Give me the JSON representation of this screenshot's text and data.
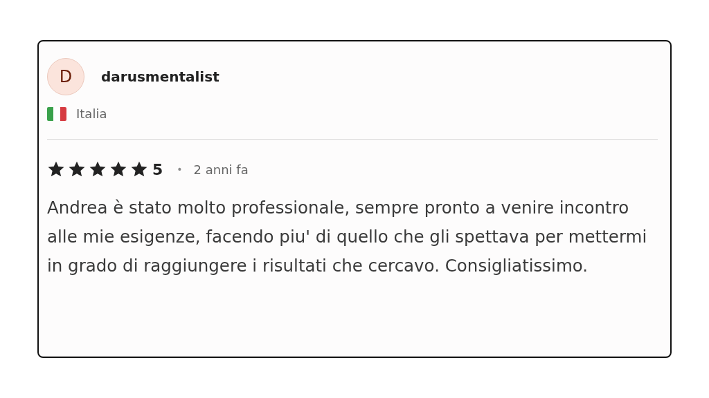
{
  "review": {
    "avatar_letter": "D",
    "author": "darusmentalist",
    "country": "Italia",
    "stars": 5,
    "rating": "5",
    "separator": "•",
    "time": "2 anni fa",
    "text": "Andrea è stato molto professionale, sempre pronto a venire incontro alle mie esigenze, facendo piu' di quello che gli spettava per mettermi in grado di raggiungere i risultati che cercavo. Consigliatissimo."
  }
}
